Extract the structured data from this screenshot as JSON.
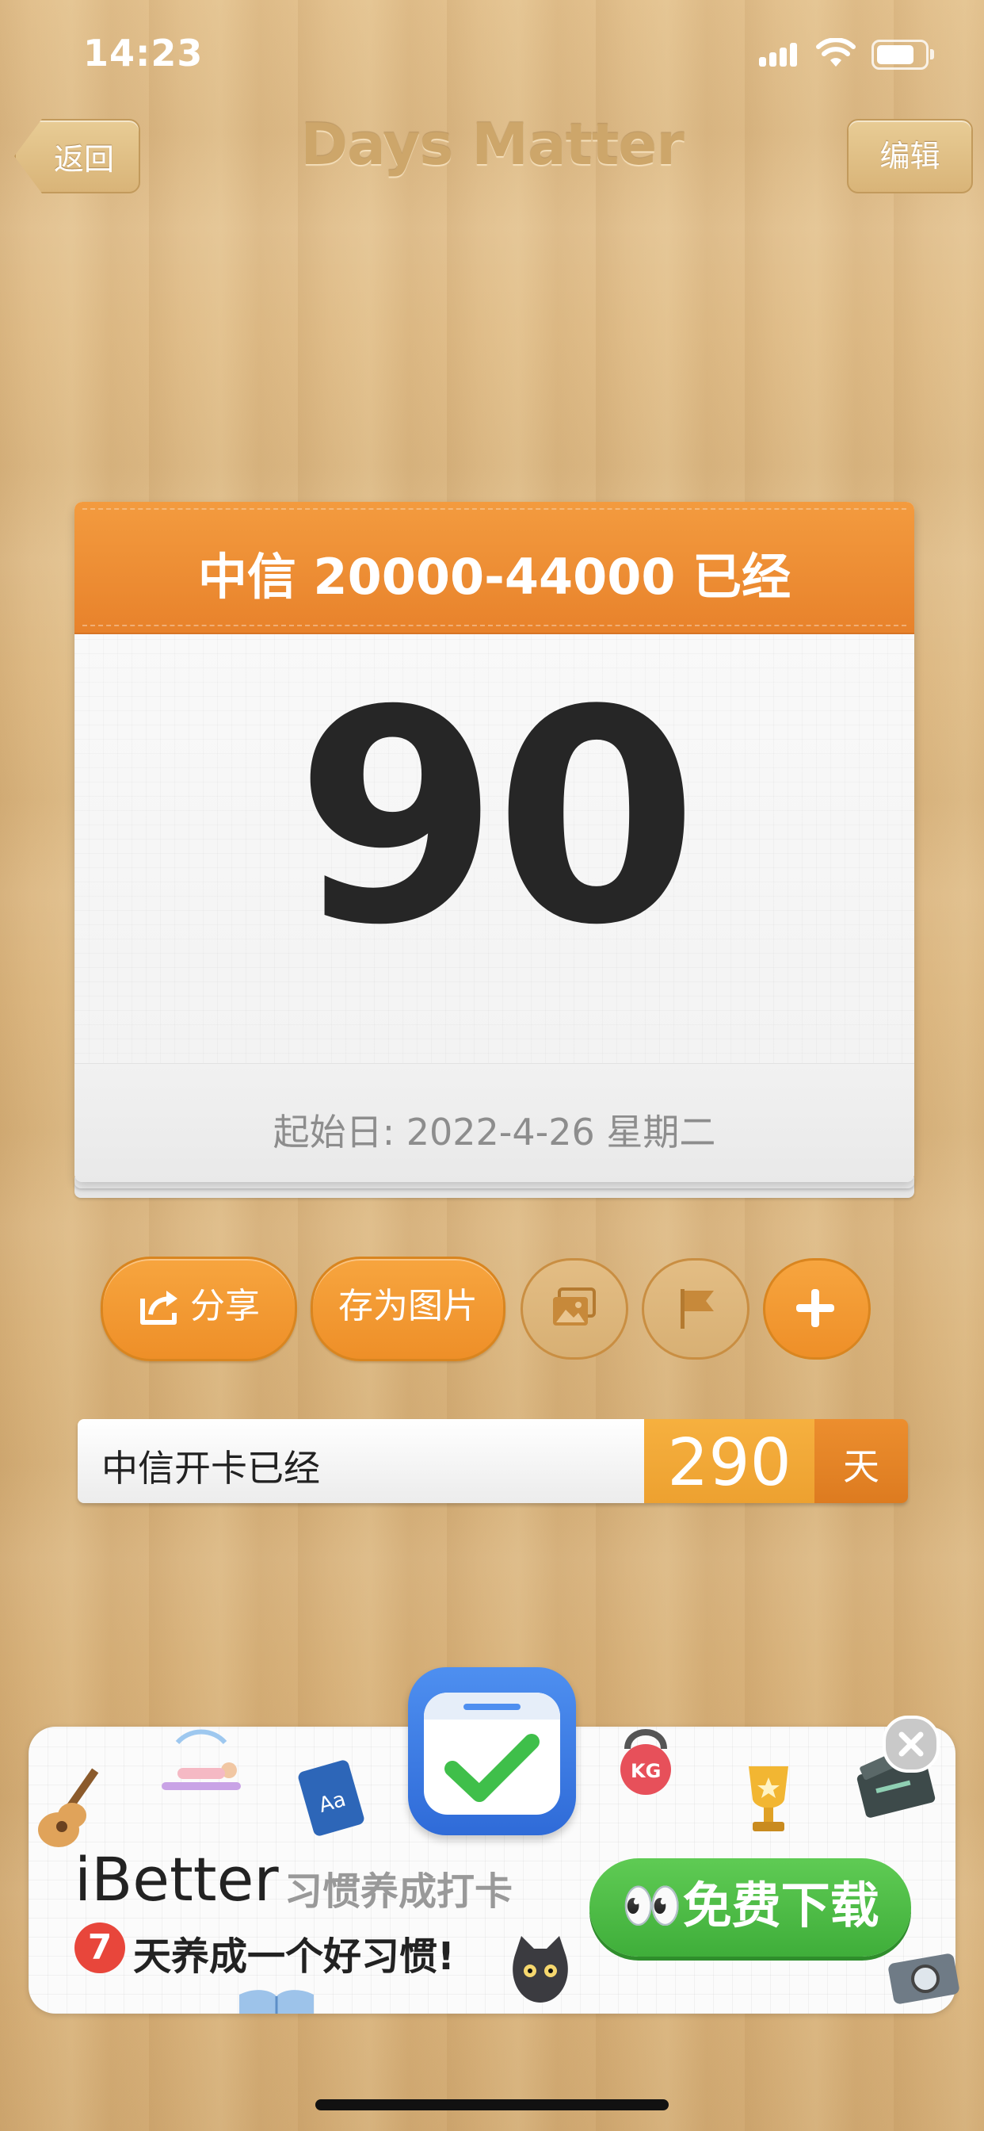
{
  "status_bar": {
    "time": "14:23"
  },
  "nav": {
    "back_label": "返回",
    "title": "Days Matter",
    "edit_label": "编辑"
  },
  "card": {
    "title": "中信 20000-44000 已经",
    "count": "90",
    "start_date": "起始日: 2022-4-26 星期二"
  },
  "actions": {
    "share_label": "分享",
    "save_image_label": "存为图片",
    "icons": [
      "share-icon",
      "image-icon",
      "flag-icon",
      "plus-icon"
    ]
  },
  "stat": {
    "label": "中信开卡已经",
    "value": "290",
    "unit": "天"
  },
  "ad": {
    "brand": "iBetter",
    "tagline": "习惯养成打卡",
    "slogan_number": "7",
    "slogan": "天养成一个好习惯!",
    "cta": "免费下载",
    "cta_icon": "👀",
    "stickers": [
      "guitar-icon",
      "yoga-icon",
      "book-icon",
      "kettlebell-icon",
      "trophy-icon",
      "clapperboard-icon",
      "cat-icon",
      "camera-icon",
      "open-book-icon"
    ],
    "sticker_texts": {
      "book": "Aa",
      "kettlebell": "KG"
    }
  },
  "colors": {
    "accent_orange": "#ee8f28",
    "header_orange": "#e8822b",
    "stat_value": "#eda130",
    "ad_green": "#3fae3a",
    "app_blue": "#2f6bd8"
  }
}
